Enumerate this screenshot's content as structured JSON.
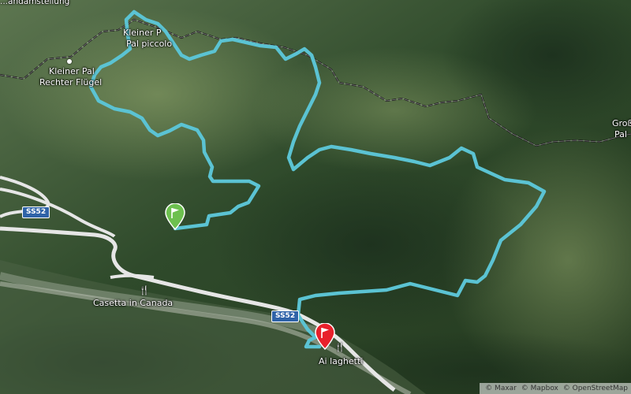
{
  "map": {
    "labels": {
      "top_left_cut": "...andamstellung",
      "kleiner_pal_left": "Kleiner Pal",
      "rechter_flugel": "Rechter Flügel",
      "kleiner_pal_top_1": "Kleiner P",
      "kleiner_pal_top_2": "Pal piccolo",
      "grosser_pal_1": "Groß",
      "grosser_pal_2": "Pal",
      "casetta": "Casetta in Canada",
      "ai_laghetti": "Ai laghetti"
    },
    "road_shields": [
      "SS52",
      "SS52"
    ],
    "attribution": [
      "© Maxar",
      "© Mapbox",
      "© OpenStreetMap"
    ],
    "route_color": "#5bc3d3",
    "start_marker_color": "#6dc04f",
    "end_marker_color": "#e8202b",
    "icons": [
      "start-flag-icon",
      "finish-flag-icon",
      "restaurant-icon",
      "peak-icon"
    ]
  }
}
